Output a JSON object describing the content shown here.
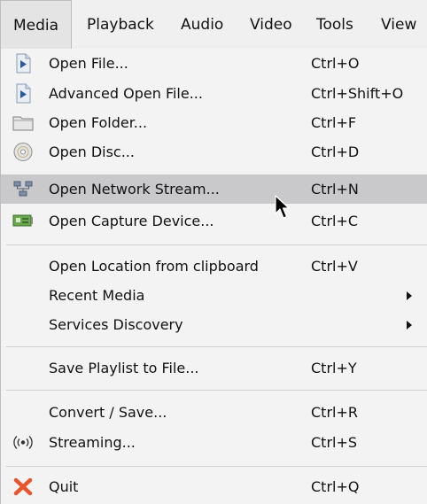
{
  "menubar": {
    "items": [
      "Media",
      "Playback",
      "Audio",
      "Video",
      "Tools",
      "View"
    ]
  },
  "media_menu": {
    "groups": [
      [
        {
          "label": "Open File...",
          "shortcut": "Ctrl+O",
          "icon": "play-file-icon"
        },
        {
          "label": "Advanced Open File...",
          "shortcut": "Ctrl+Shift+O",
          "icon": "play-file-icon"
        },
        {
          "label": "Open Folder...",
          "shortcut": "Ctrl+F",
          "icon": "folder-icon"
        },
        {
          "label": "Open Disc...",
          "shortcut": "Ctrl+D",
          "icon": "disc-icon"
        },
        {
          "label": "Open Network Stream...",
          "shortcut": "Ctrl+N",
          "icon": "network-icon",
          "highlighted": true
        },
        {
          "label": "Open Capture Device...",
          "shortcut": "Ctrl+C",
          "icon": "capture-card-icon"
        }
      ],
      [
        {
          "label": "Open Location from clipboard",
          "shortcut": "Ctrl+V"
        },
        {
          "label": "Recent Media",
          "submenu": true
        },
        {
          "label": "Services Discovery",
          "submenu": true
        }
      ],
      [
        {
          "label": "Save Playlist to File...",
          "shortcut": "Ctrl+Y"
        }
      ],
      [
        {
          "label": "Convert / Save...",
          "shortcut": "Ctrl+R"
        },
        {
          "label": "Streaming...",
          "shortcut": "Ctrl+S",
          "icon": "broadcast-icon"
        }
      ],
      [
        {
          "label": "Quit",
          "shortcut": "Ctrl+Q",
          "icon": "quit-x-icon"
        }
      ]
    ]
  },
  "colors": {
    "highlight": "#c9c9cc",
    "menu_bg": "#f3f3f3",
    "quit_icon": "#e8542c",
    "capture_icon": "#6aa84f"
  }
}
